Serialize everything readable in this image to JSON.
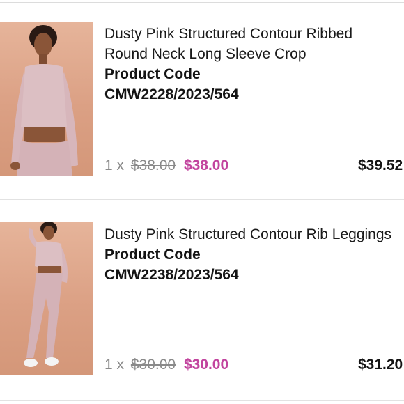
{
  "items": [
    {
      "name": "Dusty Pink Structured Contour Ribbed Round Neck Long Sleeve Crop",
      "code_label": "Product Code",
      "code": "CMW2228/2023/564",
      "quantity": "1 x",
      "original_price": "$38.00",
      "sale_price": "$38.00",
      "line_total": "$39.52"
    },
    {
      "name": "Dusty Pink Structured Contour Rib Leggings",
      "code_label": "Product Code",
      "code": "CMW2238/2023/564",
      "quantity": "1 x",
      "original_price": "$30.00",
      "sale_price": "$30.00",
      "line_total": "$31.20"
    }
  ],
  "colors": {
    "sale_price": "#c2449e",
    "muted": "#8a8a8a",
    "divider": "#dcdcdc",
    "thumb_background": "#dba084"
  }
}
